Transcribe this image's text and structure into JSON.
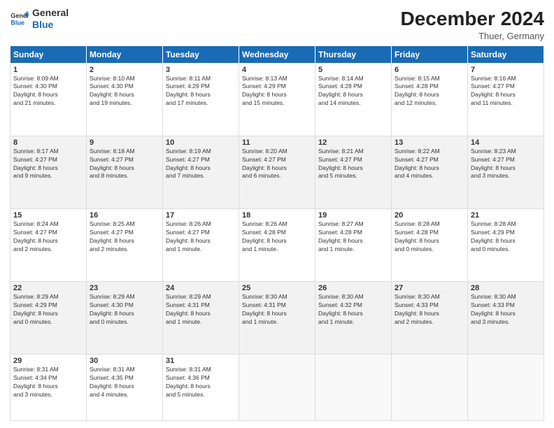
{
  "header": {
    "logo_line1": "General",
    "logo_line2": "Blue",
    "month_title": "December 2024",
    "location": "Thuer, Germany"
  },
  "days_of_week": [
    "Sunday",
    "Monday",
    "Tuesday",
    "Wednesday",
    "Thursday",
    "Friday",
    "Saturday"
  ],
  "weeks": [
    [
      {
        "day": 1,
        "info": "Sunrise: 8:09 AM\nSunset: 4:30 PM\nDaylight: 8 hours\nand 21 minutes."
      },
      {
        "day": 2,
        "info": "Sunrise: 8:10 AM\nSunset: 4:30 PM\nDaylight: 8 hours\nand 19 minutes."
      },
      {
        "day": 3,
        "info": "Sunrise: 8:11 AM\nSunset: 4:29 PM\nDaylight: 8 hours\nand 17 minutes."
      },
      {
        "day": 4,
        "info": "Sunrise: 8:13 AM\nSunset: 4:29 PM\nDaylight: 8 hours\nand 15 minutes."
      },
      {
        "day": 5,
        "info": "Sunrise: 8:14 AM\nSunset: 4:28 PM\nDaylight: 8 hours\nand 14 minutes."
      },
      {
        "day": 6,
        "info": "Sunrise: 8:15 AM\nSunset: 4:28 PM\nDaylight: 8 hours\nand 12 minutes."
      },
      {
        "day": 7,
        "info": "Sunrise: 8:16 AM\nSunset: 4:27 PM\nDaylight: 8 hours\nand 11 minutes."
      }
    ],
    [
      {
        "day": 8,
        "info": "Sunrise: 8:17 AM\nSunset: 4:27 PM\nDaylight: 8 hours\nand 9 minutes."
      },
      {
        "day": 9,
        "info": "Sunrise: 8:18 AM\nSunset: 4:27 PM\nDaylight: 8 hours\nand 8 minutes."
      },
      {
        "day": 10,
        "info": "Sunrise: 8:19 AM\nSunset: 4:27 PM\nDaylight: 8 hours\nand 7 minutes."
      },
      {
        "day": 11,
        "info": "Sunrise: 8:20 AM\nSunset: 4:27 PM\nDaylight: 8 hours\nand 6 minutes."
      },
      {
        "day": 12,
        "info": "Sunrise: 8:21 AM\nSunset: 4:27 PM\nDaylight: 8 hours\nand 5 minutes."
      },
      {
        "day": 13,
        "info": "Sunrise: 8:22 AM\nSunset: 4:27 PM\nDaylight: 8 hours\nand 4 minutes."
      },
      {
        "day": 14,
        "info": "Sunrise: 8:23 AM\nSunset: 4:27 PM\nDaylight: 8 hours\nand 3 minutes."
      }
    ],
    [
      {
        "day": 15,
        "info": "Sunrise: 8:24 AM\nSunset: 4:27 PM\nDaylight: 8 hours\nand 2 minutes."
      },
      {
        "day": 16,
        "info": "Sunrise: 8:25 AM\nSunset: 4:27 PM\nDaylight: 8 hours\nand 2 minutes."
      },
      {
        "day": 17,
        "info": "Sunrise: 8:26 AM\nSunset: 4:27 PM\nDaylight: 8 hours\nand 1 minute."
      },
      {
        "day": 18,
        "info": "Sunrise: 8:26 AM\nSunset: 4:28 PM\nDaylight: 8 hours\nand 1 minute."
      },
      {
        "day": 19,
        "info": "Sunrise: 8:27 AM\nSunset: 4:28 PM\nDaylight: 8 hours\nand 1 minute."
      },
      {
        "day": 20,
        "info": "Sunrise: 8:28 AM\nSunset: 4:28 PM\nDaylight: 8 hours\nand 0 minutes."
      },
      {
        "day": 21,
        "info": "Sunrise: 8:28 AM\nSunset: 4:29 PM\nDaylight: 8 hours\nand 0 minutes."
      }
    ],
    [
      {
        "day": 22,
        "info": "Sunrise: 8:29 AM\nSunset: 4:29 PM\nDaylight: 8 hours\nand 0 minutes."
      },
      {
        "day": 23,
        "info": "Sunrise: 8:29 AM\nSunset: 4:30 PM\nDaylight: 8 hours\nand 0 minutes."
      },
      {
        "day": 24,
        "info": "Sunrise: 8:29 AM\nSunset: 4:31 PM\nDaylight: 8 hours\nand 1 minute."
      },
      {
        "day": 25,
        "info": "Sunrise: 8:30 AM\nSunset: 4:31 PM\nDaylight: 8 hours\nand 1 minute."
      },
      {
        "day": 26,
        "info": "Sunrise: 8:30 AM\nSunset: 4:32 PM\nDaylight: 8 hours\nand 1 minute."
      },
      {
        "day": 27,
        "info": "Sunrise: 8:30 AM\nSunset: 4:33 PM\nDaylight: 8 hours\nand 2 minutes."
      },
      {
        "day": 28,
        "info": "Sunrise: 8:30 AM\nSunset: 4:33 PM\nDaylight: 8 hours\nand 3 minutes."
      }
    ],
    [
      {
        "day": 29,
        "info": "Sunrise: 8:31 AM\nSunset: 4:34 PM\nDaylight: 8 hours\nand 3 minutes."
      },
      {
        "day": 30,
        "info": "Sunrise: 8:31 AM\nSunset: 4:35 PM\nDaylight: 8 hours\nand 4 minutes."
      },
      {
        "day": 31,
        "info": "Sunrise: 8:31 AM\nSunset: 4:36 PM\nDaylight: 8 hours\nand 5 minutes."
      },
      null,
      null,
      null,
      null
    ]
  ]
}
